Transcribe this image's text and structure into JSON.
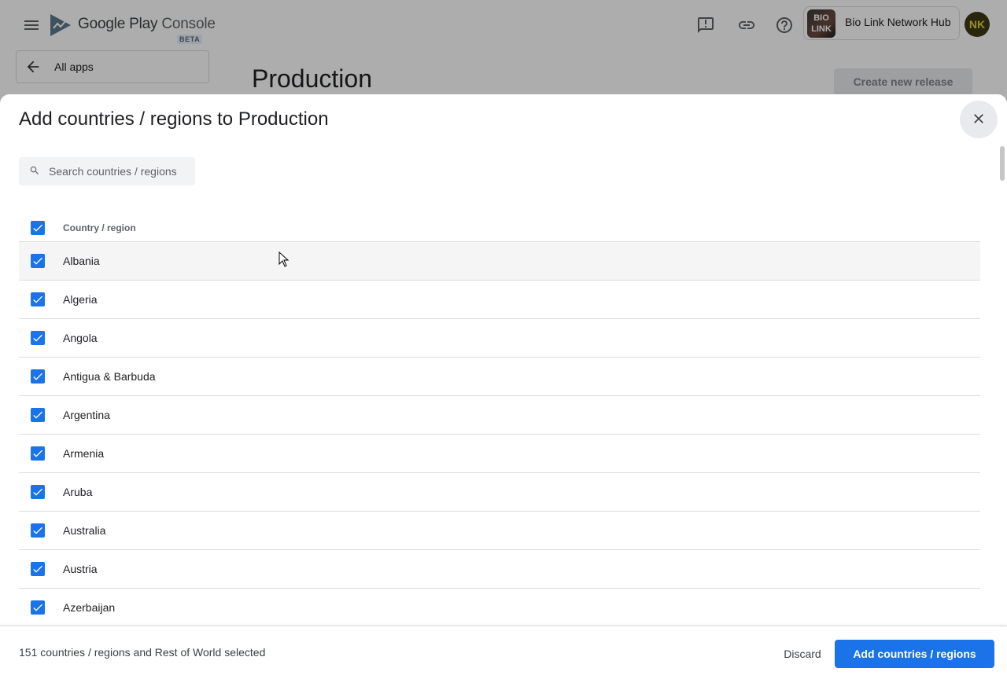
{
  "header": {
    "logo_text": "Google Play",
    "logo_text_2": "Console",
    "beta_badge": "BETA",
    "app_chip_image_text": "BIO LINK",
    "app_name": "Bio Link Network Hub",
    "avatar_initials": "NK",
    "icons": [
      "menu-icon",
      "feedback-icon",
      "link-icon",
      "help-icon"
    ]
  },
  "nav": {
    "all_apps_label": "All apps"
  },
  "page": {
    "title": "Production",
    "create_release_label": "Create new release"
  },
  "modal": {
    "title": "Add countries / regions to Production",
    "search_placeholder": "Search countries / regions",
    "search_value": "",
    "column_header": "Country / region",
    "rows": [
      {
        "name": "Albania",
        "checked": true
      },
      {
        "name": "Algeria",
        "checked": true
      },
      {
        "name": "Angola",
        "checked": true
      },
      {
        "name": "Antigua & Barbuda",
        "checked": true
      },
      {
        "name": "Argentina",
        "checked": true
      },
      {
        "name": "Armenia",
        "checked": true
      },
      {
        "name": "Aruba",
        "checked": true
      },
      {
        "name": "Australia",
        "checked": true
      },
      {
        "name": "Austria",
        "checked": true
      },
      {
        "name": "Azerbaijan",
        "checked": true
      }
    ],
    "footer": {
      "summary": "151 countries / regions and Rest of World selected",
      "discard_label": "Discard",
      "add_label": "Add countries / regions"
    }
  },
  "colors": {
    "accent": "#1a73e8",
    "scrim": "rgba(0,0,0,0.32)"
  }
}
